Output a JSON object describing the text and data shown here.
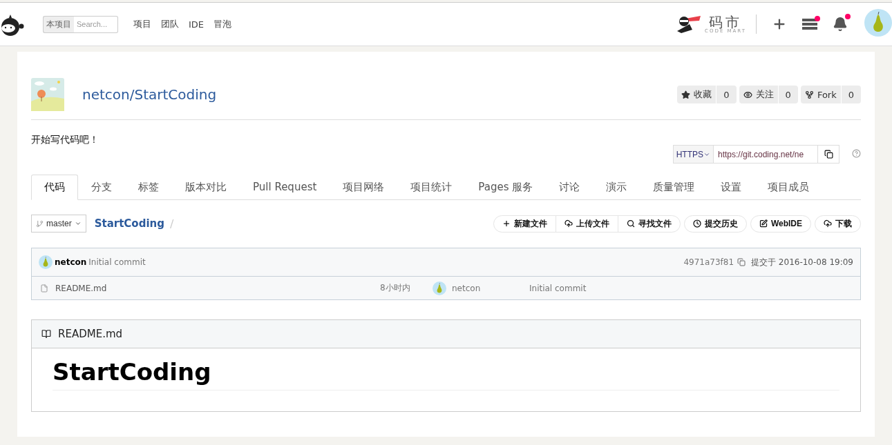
{
  "header": {
    "search": {
      "scope": "本项目",
      "placeholder": "Search..."
    },
    "nav": [
      "项目",
      "团队",
      "IDE",
      "冒泡"
    ],
    "brand": {
      "name": "码市",
      "sub": "CODE MART"
    },
    "actions": [
      {
        "kind": "plus",
        "badge": false
      },
      {
        "kind": "list",
        "badge": true
      },
      {
        "kind": "bell",
        "badge": true
      }
    ]
  },
  "project": {
    "title": "netcon/StartCoding",
    "counters": [
      {
        "kind": "star",
        "label": "收藏",
        "count": "0"
      },
      {
        "kind": "eye",
        "label": "关注",
        "count": "0"
      },
      {
        "kind": "fork",
        "label": "Fork",
        "count": "0"
      }
    ],
    "description": "开始写代码吧！",
    "clone": {
      "protocol": "HTTPS",
      "url": "https://git.coding.net/ne"
    }
  },
  "tabs": [
    {
      "label": "代码",
      "selected": true
    },
    {
      "label": "分支",
      "selected": false
    },
    {
      "label": "标签",
      "selected": false
    },
    {
      "label": "版本对比",
      "selected": false
    },
    {
      "label": "Pull Request",
      "selected": false
    },
    {
      "label": "项目网络",
      "selected": false
    },
    {
      "label": "项目统计",
      "selected": false
    },
    {
      "label": "Pages 服务",
      "selected": false
    },
    {
      "label": "讨论",
      "selected": false
    },
    {
      "label": "演示",
      "selected": false
    },
    {
      "label": "质量管理",
      "selected": false
    },
    {
      "label": "设置",
      "selected": false
    },
    {
      "label": "项目成员",
      "selected": false
    }
  ],
  "branch": "master",
  "repo": "StartCoding",
  "separator": "/",
  "file_action_groups": [
    [
      {
        "kind": "plus",
        "label": "新建文件"
      },
      {
        "kind": "cloud",
        "label": "上传文件"
      },
      {
        "kind": "search",
        "label": "寻找文件"
      }
    ],
    [
      {
        "kind": "clock",
        "label": "提交历史"
      }
    ],
    [
      {
        "kind": "edit",
        "label": "WebIDE"
      }
    ],
    [
      {
        "kind": "cloud",
        "label": "下载"
      }
    ]
  ],
  "commit": {
    "author": "netcon",
    "message": "Initial commit",
    "hash": "4971a73f81",
    "time": "提交于 2016-10-08 19:09"
  },
  "files": [
    {
      "name": "README.md",
      "age": "8小时内",
      "author": "netcon",
      "message": "Initial commit"
    }
  ],
  "readme": {
    "title": "README.md",
    "heading": "StartCoding"
  }
}
